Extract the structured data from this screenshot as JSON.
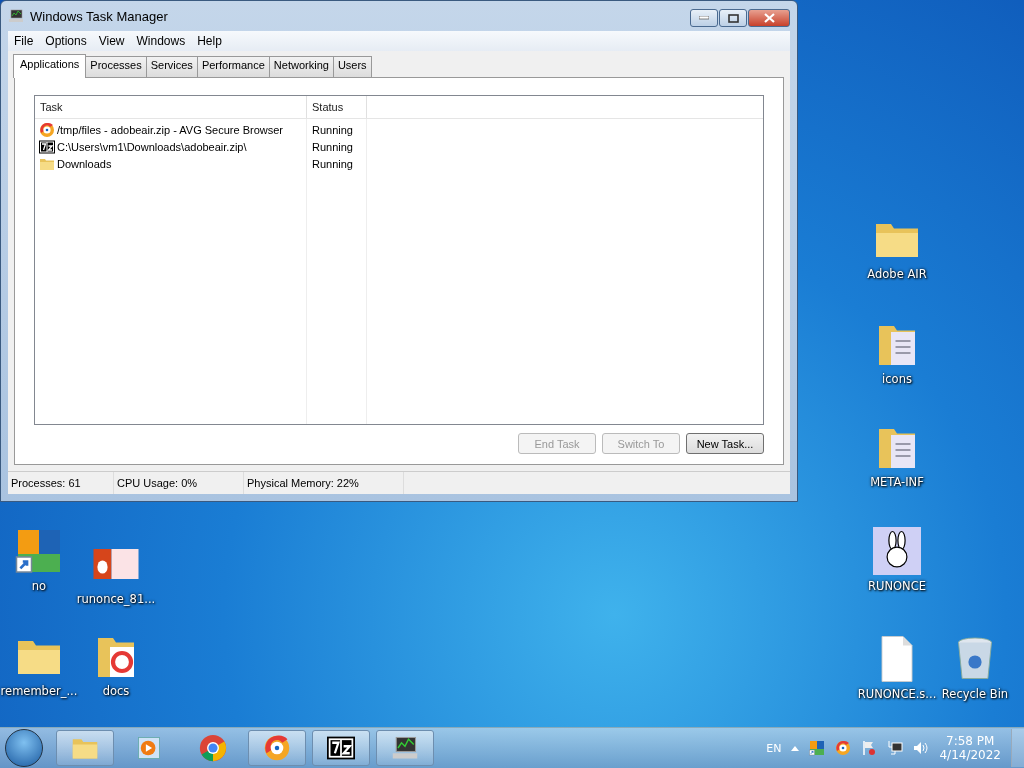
{
  "window": {
    "title": "Windows Task Manager",
    "menu": [
      "File",
      "Options",
      "View",
      "Windows",
      "Help"
    ],
    "tabs": [
      {
        "label": "Applications",
        "selected": true
      },
      {
        "label": "Processes",
        "selected": false
      },
      {
        "label": "Services",
        "selected": false
      },
      {
        "label": "Performance",
        "selected": false
      },
      {
        "label": "Networking",
        "selected": false
      },
      {
        "label": "Users",
        "selected": false
      }
    ],
    "columns": [
      "Task",
      "Status"
    ],
    "rows": [
      {
        "kind": "browser",
        "task": "/tmp/files - adobeair.zip - AVG Secure Browser",
        "status": "Running"
      },
      {
        "kind": "archive",
        "task": "C:\\Users\\vm1\\Downloads\\adobeair.zip\\",
        "status": "Running"
      },
      {
        "kind": "folder",
        "task": "Downloads",
        "status": "Running"
      }
    ],
    "buttons": [
      {
        "label": "End Task",
        "disabled": true
      },
      {
        "label": "Switch To",
        "disabled": true
      },
      {
        "label": "New Task...",
        "disabled": false
      }
    ],
    "status_bar": [
      "Processes: 61",
      "CPU Usage: 0%",
      "Physical Memory: 22%"
    ]
  },
  "desktop_icons": [
    {
      "kind": "shortcut",
      "label": "no"
    },
    {
      "kind": "image",
      "label": "runonce_81..."
    },
    {
      "kind": "folder",
      "label": "remember_..."
    },
    {
      "kind": "folder-app",
      "label": "docs"
    },
    {
      "kind": "folder",
      "label": "Adobe AIR"
    },
    {
      "kind": "folder-doc",
      "label": "icons"
    },
    {
      "kind": "folder-doc",
      "label": "META-INF"
    },
    {
      "kind": "bunny",
      "label": "RUNONCE"
    },
    {
      "kind": "file",
      "label": "RUNONCE.s..."
    },
    {
      "kind": "bin",
      "label": "Recycle Bin"
    }
  ],
  "taskbar": {
    "buttons": [
      {
        "kind": "explorer",
        "active": true
      },
      {
        "kind": "player",
        "active": false
      },
      {
        "kind": "chrome",
        "active": false
      },
      {
        "kind": "browser",
        "active": true
      },
      {
        "kind": "archive",
        "active": true
      },
      {
        "kind": "monitor",
        "active": true
      }
    ],
    "language": "EN",
    "time": "7:58 PM",
    "date": "4/14/2022"
  }
}
